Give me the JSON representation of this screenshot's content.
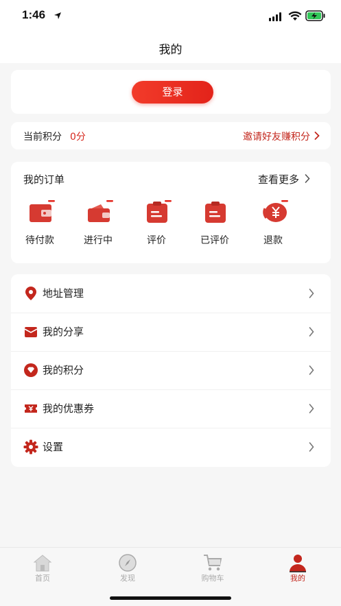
{
  "status_bar": {
    "time": "1:46"
  },
  "nav": {
    "title": "我的"
  },
  "login": {
    "button_label": "登录"
  },
  "points": {
    "label": "当前积分",
    "value": "0分",
    "invite_label": "邀请好友赚积分"
  },
  "orders": {
    "title": "我的订单",
    "more_label": "查看更多",
    "items": [
      {
        "label": "待付款",
        "icon": "wallet-icon"
      },
      {
        "label": "进行中",
        "icon": "wallet-open-icon"
      },
      {
        "label": "评价",
        "icon": "clipboard-icon"
      },
      {
        "label": "已评价",
        "icon": "clipboard-done-icon"
      },
      {
        "label": "退款",
        "icon": "refund-yen-icon"
      }
    ]
  },
  "menu": {
    "items": [
      {
        "label": "地址管理",
        "icon": "location-pin-icon"
      },
      {
        "label": "我的分享",
        "icon": "envelope-icon"
      },
      {
        "label": "我的积分",
        "icon": "diamond-icon"
      },
      {
        "label": "我的优惠券",
        "icon": "coupon-icon"
      },
      {
        "label": "设置",
        "icon": "gear-icon"
      }
    ]
  },
  "tabbar": {
    "items": [
      {
        "label": "首页",
        "icon": "home-icon"
      },
      {
        "label": "发现",
        "icon": "compass-icon"
      },
      {
        "label": "购物车",
        "icon": "cart-icon"
      },
      {
        "label": "我的",
        "icon": "user-icon"
      }
    ],
    "active_index": 3
  },
  "colors": {
    "accent": "#e3231a",
    "accent_text": "#c3271d",
    "background": "#f6f6f6"
  }
}
